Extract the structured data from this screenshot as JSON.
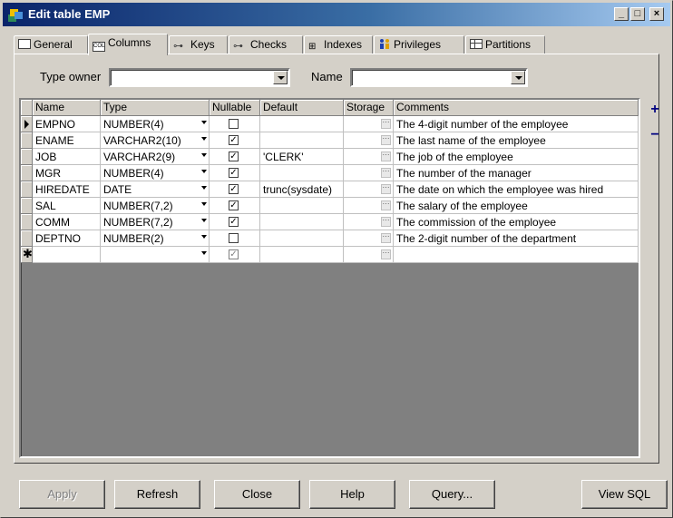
{
  "window": {
    "title": "Edit table EMP",
    "minimize_glyph": "_",
    "maximize_glyph": "□",
    "close_glyph": "×"
  },
  "tabs": [
    {
      "label": "General",
      "icon": "general-icon"
    },
    {
      "label": "Columns",
      "icon": "columns-icon",
      "active": true
    },
    {
      "label": "Keys",
      "icon": "keys-icon"
    },
    {
      "label": "Checks",
      "icon": "checks-icon"
    },
    {
      "label": "Indexes",
      "icon": "indexes-icon"
    },
    {
      "label": "Privileges",
      "icon": "privileges-icon"
    },
    {
      "label": "Partitions",
      "icon": "partitions-icon"
    }
  ],
  "filters": {
    "type_owner_label": "Type owner",
    "type_owner_value": "",
    "name_label": "Name",
    "name_value": ""
  },
  "grid": {
    "headers": [
      "Name",
      "Type",
      "Nullable",
      "Default",
      "Storage",
      "Comments"
    ],
    "rows": [
      {
        "name": "EMPNO",
        "type": "NUMBER(4)",
        "nullable": false,
        "default": "",
        "comments": "The 4-digit number of the employee",
        "current": true
      },
      {
        "name": "ENAME",
        "type": "VARCHAR2(10)",
        "nullable": true,
        "default": "",
        "comments": "The last name of the employee"
      },
      {
        "name": "JOB",
        "type": "VARCHAR2(9)",
        "nullable": true,
        "default": "'CLERK'",
        "comments": "The job of the employee"
      },
      {
        "name": "MGR",
        "type": "NUMBER(4)",
        "nullable": true,
        "default": "",
        "comments": "The number of the manager"
      },
      {
        "name": "HIREDATE",
        "type": "DATE",
        "nullable": true,
        "default": "trunc(sysdate)",
        "comments": "The date on which the employee was hired"
      },
      {
        "name": "SAL",
        "type": "NUMBER(7,2)",
        "nullable": true,
        "default": "",
        "comments": "The salary of the employee"
      },
      {
        "name": "COMM",
        "type": "NUMBER(7,2)",
        "nullable": true,
        "default": "",
        "comments": "The commission of the employee"
      },
      {
        "name": "DEPTNO",
        "type": "NUMBER(2)",
        "nullable": false,
        "default": "",
        "comments": "The 2-digit number of the department"
      }
    ],
    "new_row": {
      "name": "",
      "type": "",
      "nullable": true,
      "default": "",
      "comments": ""
    },
    "checked_glyph": "✓",
    "ellipsis_glyph": "···",
    "new_row_glyph": "✱"
  },
  "side_buttons": {
    "add": "+",
    "remove": "−"
  },
  "buttons": {
    "apply": "Apply",
    "refresh": "Refresh",
    "close": "Close",
    "help": "Help",
    "query": "Query...",
    "view_sql": "View SQL"
  },
  "colors": {
    "title_start": "#0a246a",
    "title_end": "#a6caf0",
    "face": "#d4d0c8",
    "side_button": "#000080"
  }
}
